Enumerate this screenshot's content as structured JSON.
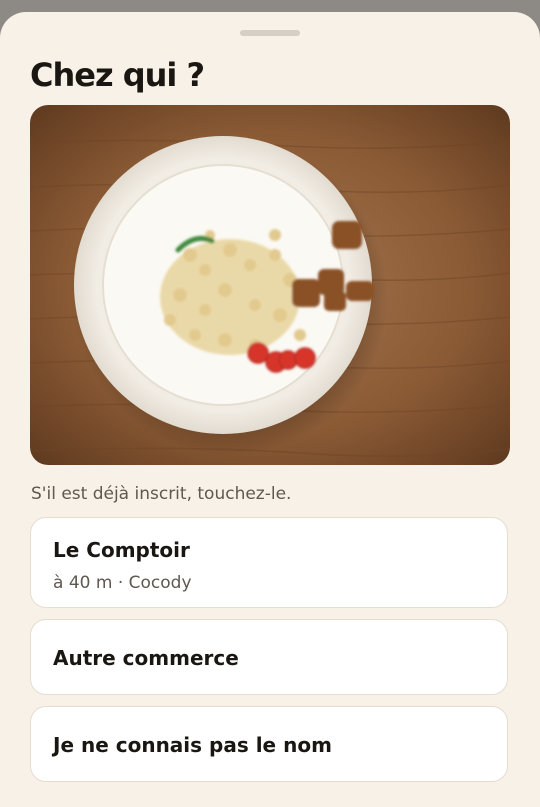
{
  "sheet": {
    "title": "Chez qui ?",
    "photo_alt": "plate-photo",
    "hint": "S'il est déjà inscrit, touchez-le.",
    "options": [
      {
        "name": "Le Comptoir",
        "detail": "à 40 m · Cocody"
      },
      {
        "name": "Autre commerce"
      },
      {
        "name": "Je ne connais pas le nom"
      }
    ]
  },
  "colors": {
    "background": "#f7f1e8",
    "card": "#ffffff",
    "card_border": "#e6ddd0",
    "text": "#1a1612",
    "muted": "#5e5850",
    "wood": "#8a5a35"
  }
}
